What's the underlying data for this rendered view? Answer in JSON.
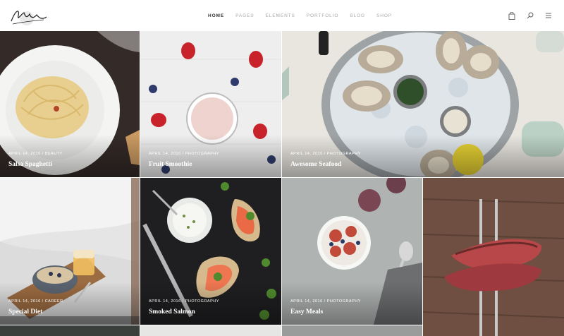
{
  "nav": {
    "items": [
      "HOME",
      "PAGES",
      "ELEMENTS",
      "PORTFOLIO",
      "BLOG",
      "SHOP"
    ],
    "active": "HOME"
  },
  "header_icons": [
    "shopping-bag-icon",
    "search-icon",
    "menu-icon"
  ],
  "posts": [
    {
      "date": "APRIL 14, 2016",
      "category": "BEAUTY",
      "meta": "APRIL 14, 2016 / BEAUTY",
      "title": "Salsa Spaghetti"
    },
    {
      "date": "APRIL 14, 2016",
      "category": "PHOTOGRAPHY",
      "meta": "APRIL 14, 2016 / PHOTOGRAPHY",
      "title": "Fruit Smoothie"
    },
    {
      "date": "APRIL 14, 2016",
      "category": "PHOTOGRAPHY",
      "meta": "APRIL 14, 2016 / PHOTOGRAPHY",
      "title": "Awesome Seafood"
    },
    {
      "date": "APRIL 14, 2016",
      "category": "CAREER",
      "meta": "APRIL 14, 2016 / CAREER",
      "title": "Special Diet"
    },
    {
      "date": "APRIL 14, 2016",
      "category": "PHOTOGRAPHY",
      "meta": "APRIL 14, 2016 / PHOTOGRAPHY",
      "title": "Smoked Salmon"
    },
    {
      "date": "APRIL 14, 2016",
      "category": "PHOTOGRAPHY",
      "meta": "APRIL 14, 2016 / PHOTOGRAPHY",
      "title": "Easy Meals"
    }
  ]
}
